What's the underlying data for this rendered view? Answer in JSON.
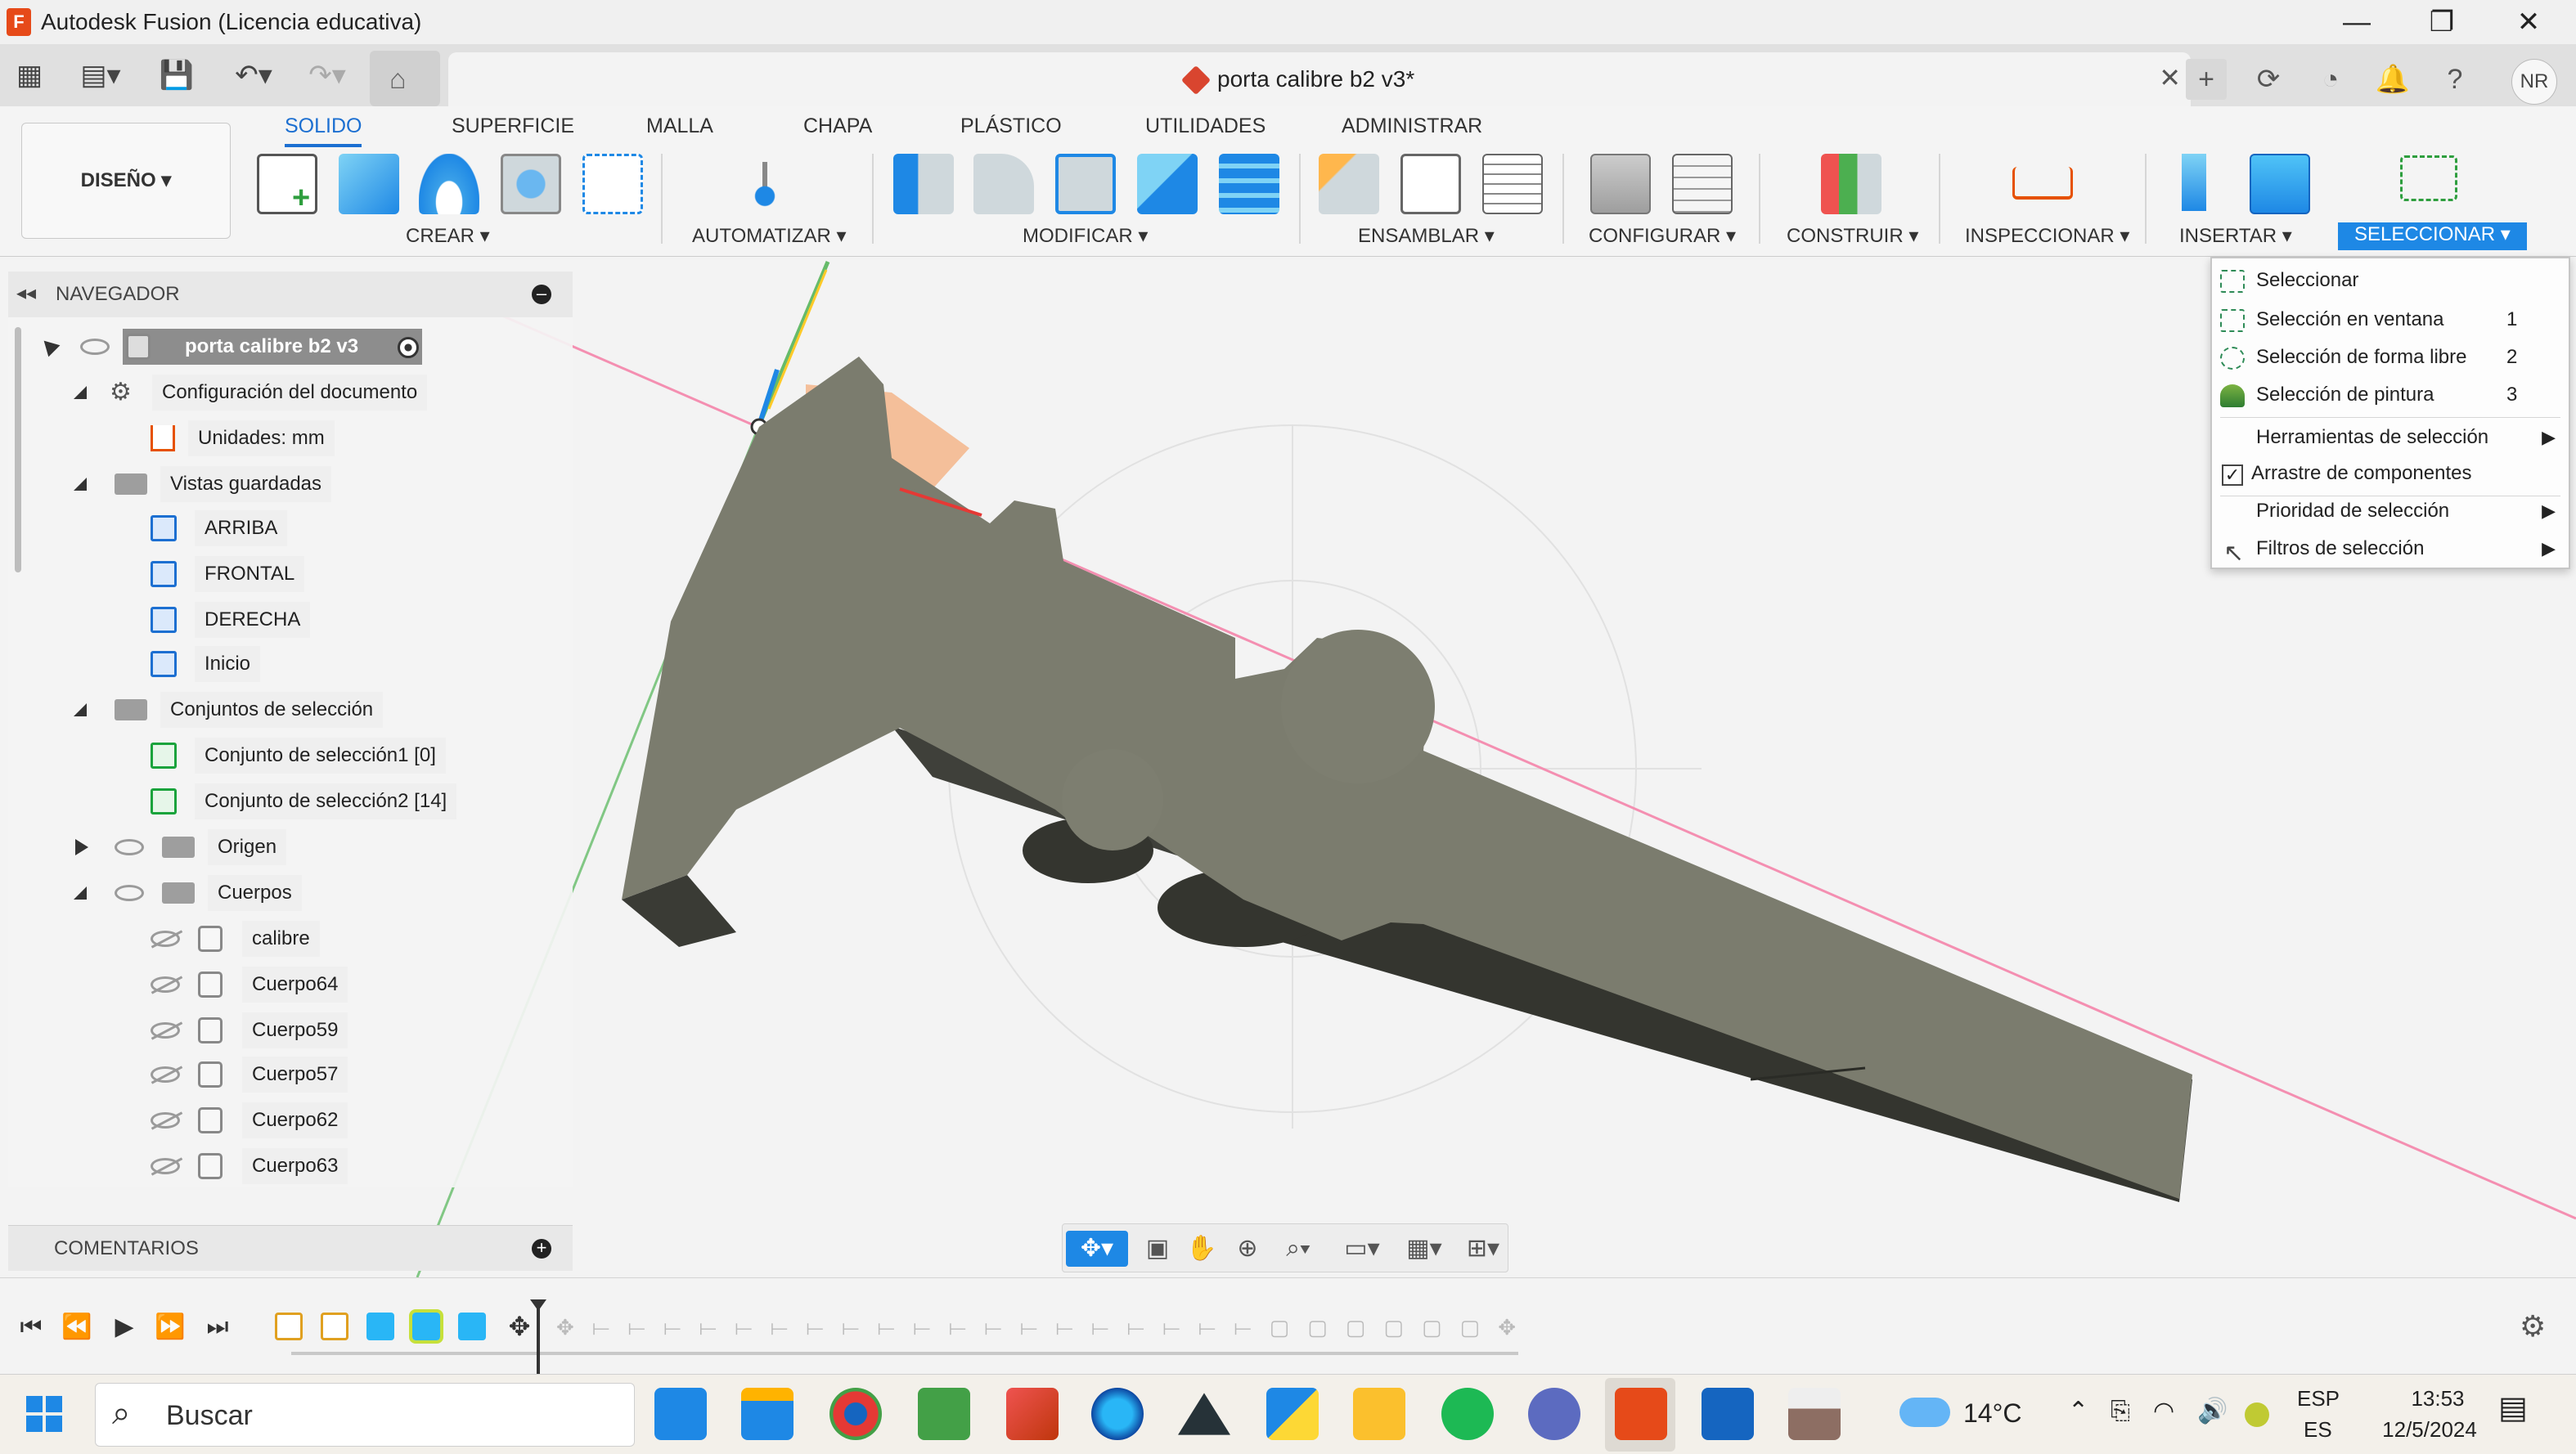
{
  "window": {
    "title": "Autodesk Fusion (Licencia educativa)",
    "app_icon_letter": "F",
    "minimize": "—",
    "restore": "❐",
    "close": "✕"
  },
  "document": {
    "tab_name": "porta calibre b2 v3*",
    "close": "✕"
  },
  "user": {
    "initials": "NR"
  },
  "workspace": {
    "tabs": [
      "SOLIDO",
      "SUPERFICIE",
      "MALLA",
      "CHAPA",
      "PLÁSTICO",
      "UTILIDADES",
      "ADMINISTRAR"
    ],
    "active_tab": "SOLIDO",
    "mode_button": "DISEÑO ▾"
  },
  "ribbon_groups": {
    "crear": "CREAR ▾",
    "automatizar": "AUTOMATIZAR ▾",
    "modificar": "MODIFICAR ▾",
    "ensamblar": "ENSAMBLAR ▾",
    "configurar": "CONFIGURAR ▾",
    "construir": "CONSTRUIR ▾",
    "inspeccionar": "INSPECCIONAR ▾",
    "insertar": "INSERTAR ▾",
    "seleccionar": "SELECCIONAR ▾"
  },
  "navigator": {
    "title": "NAVEGADOR",
    "root": "porta calibre b2 v3",
    "doc_settings": "Configuración del documento",
    "units": "Unidades: mm",
    "saved_views": "Vistas guardadas",
    "views": [
      "ARRIBA",
      "FRONTAL",
      "DERECHA",
      "Inicio"
    ],
    "selection_sets_folder": "Conjuntos de selección",
    "selection_sets": [
      "Conjunto de selección1 [0]",
      "Conjunto de selección2 [14]"
    ],
    "origin": "Origen",
    "bodies_folder": "Cuerpos",
    "bodies": [
      "calibre",
      "Cuerpo64",
      "Cuerpo59",
      "Cuerpo57",
      "Cuerpo62",
      "Cuerpo63"
    ]
  },
  "comments": {
    "title": "COMENTARIOS"
  },
  "selection_menu": {
    "items": [
      {
        "label": "Seleccionar",
        "shortcut": ""
      },
      {
        "label": "Selección en ventana",
        "shortcut": "1"
      },
      {
        "label": "Selección de forma libre",
        "shortcut": "2"
      },
      {
        "label": "Selección de pintura",
        "shortcut": "3"
      },
      {
        "label": "Herramientas de selección",
        "shortcut": "▶"
      },
      {
        "label": "Arrastre de componentes",
        "shortcut": ""
      },
      {
        "label": "Prioridad de selección",
        "shortcut": "▶"
      },
      {
        "label": "Filtros de selección",
        "shortcut": "▶"
      }
    ]
  },
  "taskbar": {
    "search_placeholder": "Buscar",
    "weather": "14°C",
    "lang_top": "ESP",
    "lang_bottom": "ES",
    "time": "13:53",
    "date": "12/5/2024"
  },
  "colors": {
    "accent": "#1e88e5",
    "model": "#7b7c6e",
    "model_dark": "#3f403a",
    "axis_red": "#f06292",
    "axis_green": "#66bb6a"
  }
}
